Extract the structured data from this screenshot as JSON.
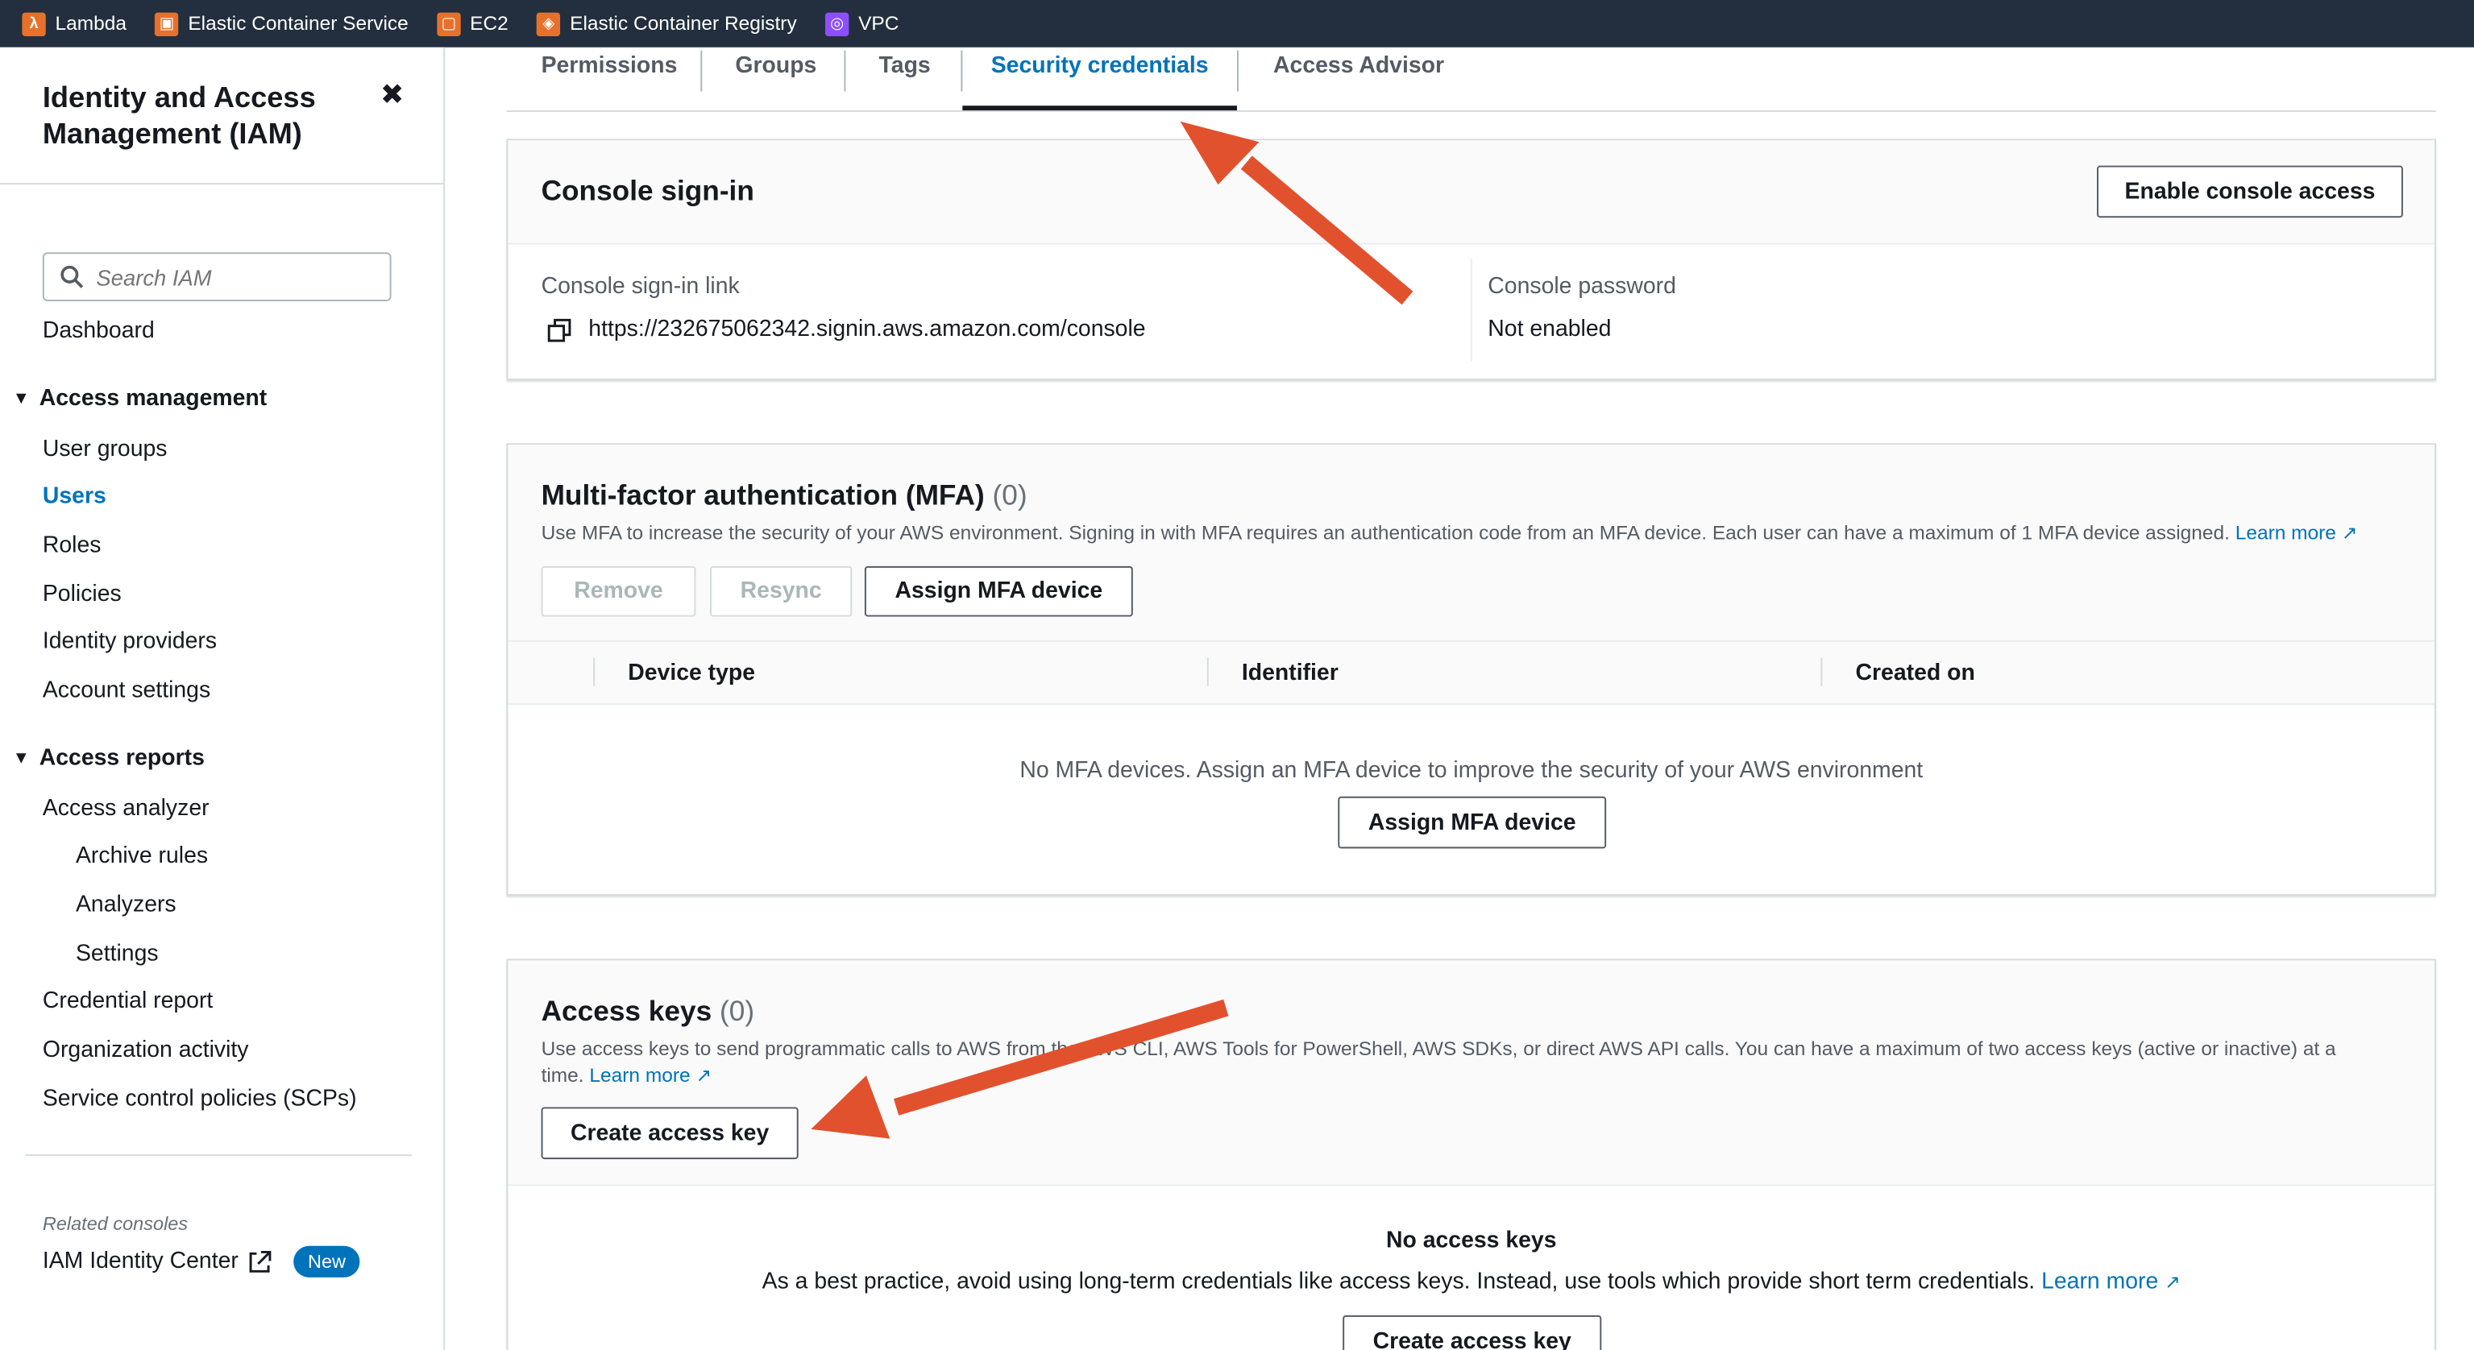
{
  "topbar": {
    "favorites": [
      {
        "label": "Lambda",
        "icon": "lambda-icon",
        "color": "#e7712b"
      },
      {
        "label": "Elastic Container Service",
        "icon": "ecs-icon",
        "color": "#e7712b"
      },
      {
        "label": "EC2",
        "icon": "ec2-icon",
        "color": "#e7712b"
      },
      {
        "label": "Elastic Container Registry",
        "icon": "ecr-icon",
        "color": "#e7712b"
      },
      {
        "label": "VPC",
        "icon": "vpc-icon",
        "color": "#8c4fff"
      }
    ]
  },
  "sidebar": {
    "title": "Identity and Access Management (IAM)",
    "search_placeholder": "Search IAM",
    "dashboard": "Dashboard",
    "access_management": {
      "heading": "Access management",
      "items": [
        "User groups",
        "Users",
        "Roles",
        "Policies",
        "Identity providers",
        "Account settings"
      ]
    },
    "access_reports": {
      "heading": "Access reports",
      "items": [
        "Access analyzer",
        "Archive rules",
        "Analyzers",
        "Settings",
        "Credential report",
        "Organization activity",
        "Service control policies (SCPs)"
      ]
    },
    "related_consoles": "Related consoles",
    "iam_identity_center": "IAM Identity Center",
    "new_badge": "New"
  },
  "tabs": [
    "Permissions",
    "Groups",
    "Tags",
    "Security credentials",
    "Access Advisor"
  ],
  "console_signin": {
    "title": "Console sign-in",
    "enable_button": "Enable console access",
    "link_label": "Console sign-in link",
    "link_value": "https://232675062342.signin.aws.amazon.com/console",
    "password_label": "Console password",
    "password_value": "Not enabled"
  },
  "mfa": {
    "title": "Multi-factor authentication (MFA)",
    "count": "(0)",
    "description": "Use MFA to increase the security of your AWS environment. Signing in with MFA requires an authentication code from an MFA device. Each user can have a maximum of 1 MFA device assigned.",
    "learn_more": "Learn more",
    "remove_button": "Remove",
    "resync_button": "Resync",
    "assign_button": "Assign MFA device",
    "columns": [
      "Device type",
      "Identifier",
      "Created on"
    ],
    "empty_text": "No MFA devices. Assign an MFA device to improve the security of your AWS environment",
    "empty_assign_button": "Assign MFA device"
  },
  "access_keys": {
    "title": "Access keys",
    "count": "(0)",
    "description_a": "Use access keys to send programmatic calls to AWS from th",
    "description_b": "e AWS CLI, AWS Tools for PowerShell, AWS SDKs, or direct AWS API calls. You can have a maximum of two access keys (active or inactive) at a",
    "description_c": "time.",
    "learn_more": "Learn more",
    "create_button": "Create access key",
    "empty_title": "No access keys",
    "empty_text": "As a best practice, avoid using long-term credentials like access keys. Instead, use tools which provide short term credentials.",
    "empty_learn_more": "Learn more",
    "empty_create_button": "Create access key"
  },
  "annotation_color": "#e2512d"
}
